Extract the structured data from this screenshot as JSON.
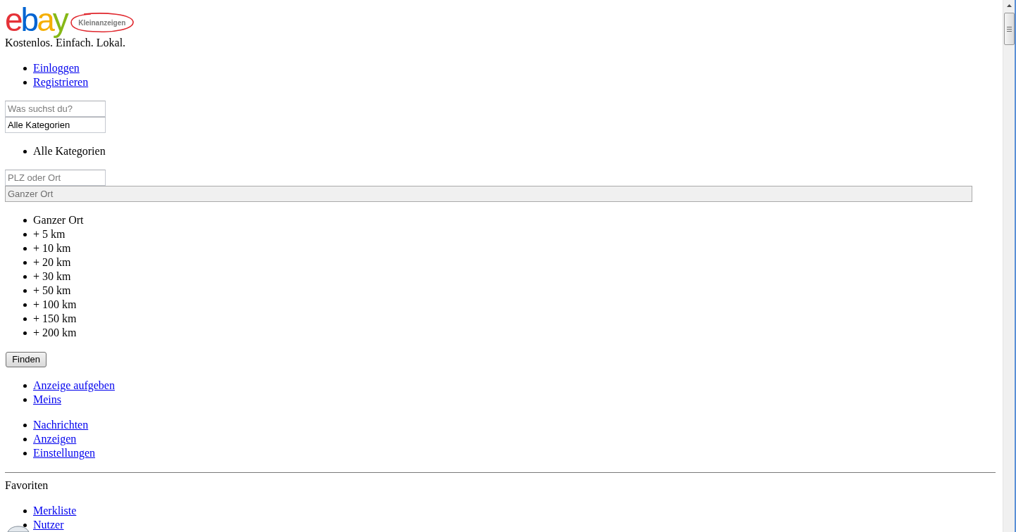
{
  "logo": {
    "wordmark": "ebay",
    "badge": "Kleinanzeigen"
  },
  "tagline": "Kostenlos. Einfach. Lokal.",
  "account_links": [
    "Einloggen",
    "Registrieren"
  ],
  "search_form": {
    "query_field": {
      "placeholder": "Was suchst du?"
    },
    "category_field": {
      "value": "Alle Kategorien"
    },
    "category_options": [
      "Alle Kategorien"
    ],
    "location_field": {
      "placeholder": "PLZ oder Ort"
    },
    "radius_field": {
      "value": "Ganzer Ort",
      "disabled": true
    },
    "radius_options": [
      "Ganzer Ort",
      "+ 5 km",
      "+ 10 km",
      "+ 20 km",
      "+ 30 km",
      "+ 50 km",
      "+ 100 km",
      "+ 150 km",
      "+ 200 km"
    ],
    "submit_button": "Finden"
  },
  "main_links": [
    "Anzeige aufgeben",
    "Meins"
  ],
  "meins_links": [
    "Nachrichten",
    "Anzeigen",
    "Einstellungen"
  ],
  "favorites": {
    "heading": "Favoriten",
    "links": [
      "Merkliste",
      "Nutzer"
    ]
  }
}
